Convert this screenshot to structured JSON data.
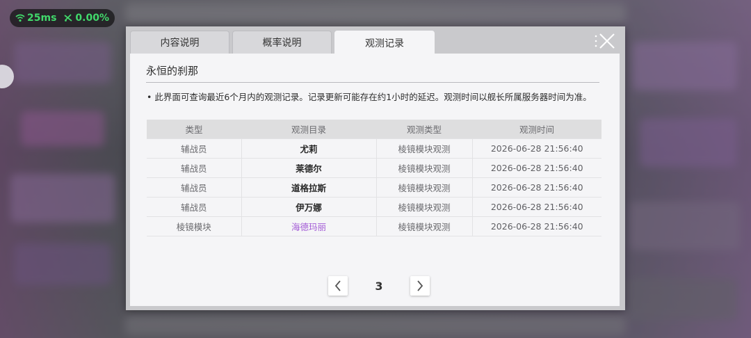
{
  "status": {
    "ping": "25ms",
    "loss": "0.00%"
  },
  "tabs": [
    {
      "label": "内容说明"
    },
    {
      "label": "概率说明"
    },
    {
      "label": "观测记录"
    }
  ],
  "active_tab": 2,
  "panel": {
    "title": "永恒的刹那",
    "notice": "• 此界面可查询最近6个月内的观测记录。记录更新可能存在约1小时的延迟。观测时间以舰长所属服务器时间为准。"
  },
  "table": {
    "headers": [
      "类型",
      "观测目录",
      "观测类型",
      "观测时间"
    ],
    "rows": [
      {
        "type": "辅战员",
        "target": "尤莉",
        "obs_type": "棱镜模块观测",
        "time": "2026-06-28 21:56:40"
      },
      {
        "type": "辅战员",
        "target": "莱德尔",
        "obs_type": "棱镜模块观测",
        "time": "2026-06-28 21:56:40"
      },
      {
        "type": "辅战员",
        "target": "道格拉斯",
        "obs_type": "棱镜模块观测",
        "time": "2026-06-28 21:56:40"
      },
      {
        "type": "辅战员",
        "target": "伊万娜",
        "obs_type": "棱镜模块观测",
        "time": "2026-06-28 21:56:40"
      },
      {
        "type": "棱镜模块",
        "target": "海德玛丽",
        "obs_type": "棱镜模块观测",
        "time": "2026-06-28 21:56:40",
        "highlight": true
      }
    ],
    "highlight_color": "#a35bd6"
  },
  "pagination": {
    "current_page": "3"
  },
  "colors": {
    "status_green": "#41d96b",
    "panel_bg": "#f5f5f7"
  }
}
